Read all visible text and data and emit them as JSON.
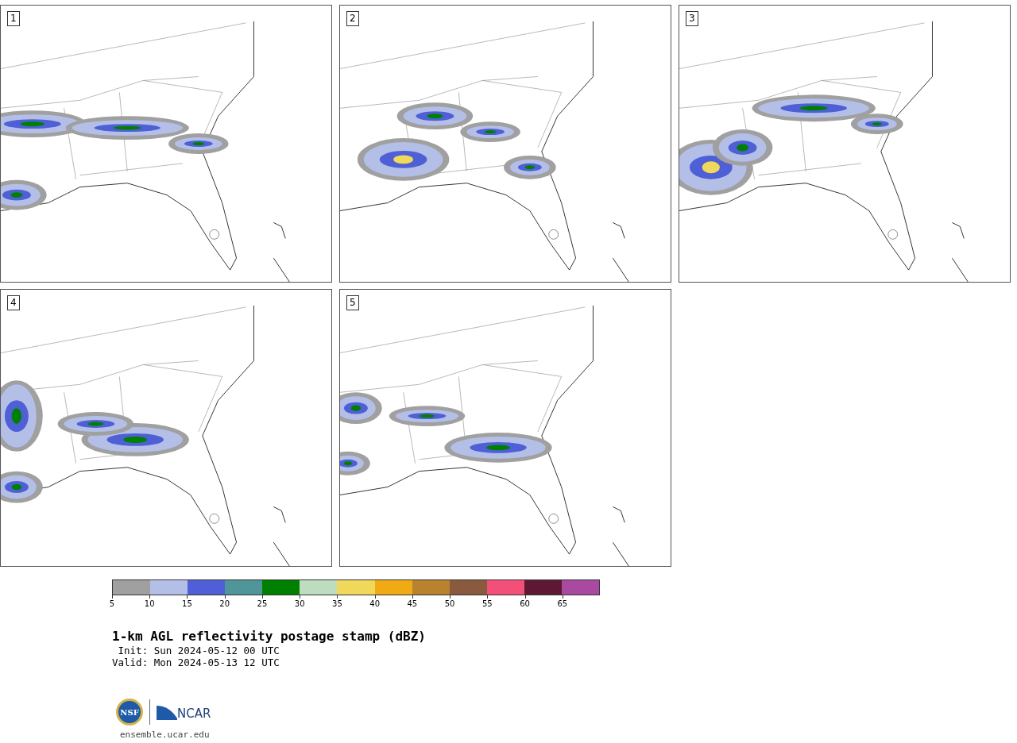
{
  "panels": [
    {
      "label": "1"
    },
    {
      "label": "2"
    },
    {
      "label": "3"
    },
    {
      "label": "4"
    },
    {
      "label": "5"
    }
  ],
  "colorbar": {
    "bins": [
      {
        "color": "#a0a0a0"
      },
      {
        "color": "#b4bfe8"
      },
      {
        "color": "#4f5fd6"
      },
      {
        "color": "#4f9599"
      },
      {
        "color": "#008000"
      },
      {
        "color": "#bedcbe"
      },
      {
        "color": "#f0d85a"
      },
      {
        "color": "#f0aa14"
      },
      {
        "color": "#b8822e"
      },
      {
        "color": "#8a5a3e"
      },
      {
        "color": "#f25078"
      },
      {
        "color": "#5e1834"
      },
      {
        "color": "#a94aa0"
      }
    ],
    "ticks": [
      "5",
      "10",
      "15",
      "20",
      "25",
      "30",
      "35",
      "40",
      "45",
      "50",
      "55",
      "60",
      "65"
    ]
  },
  "title": "1-km AGL reflectivity postage stamp (dBZ)",
  "init": " Init: Sun 2024-05-12 00 UTC",
  "valid": "Valid: Mon 2024-05-13 12 UTC",
  "logos": {
    "left": "NSF",
    "right": "NCAR"
  },
  "url": "ensemble.ucar.edu"
}
